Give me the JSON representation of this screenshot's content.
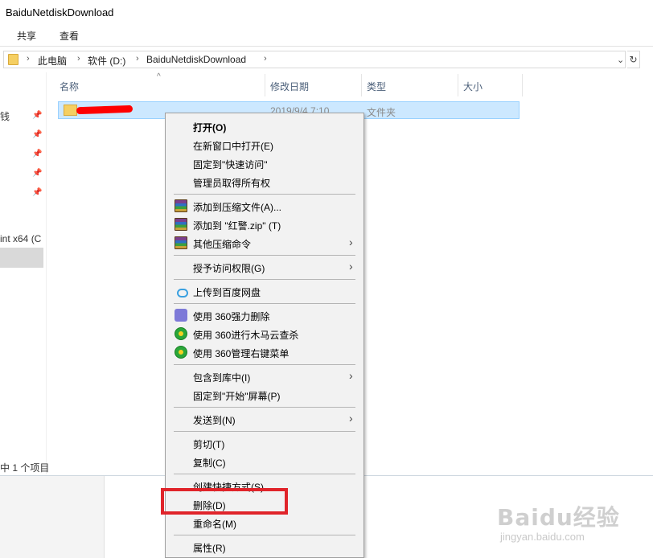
{
  "window": {
    "title": "BaiduNetdiskDownload"
  },
  "ribbon": {
    "tabs": [
      "共享",
      "查看"
    ]
  },
  "address": {
    "crumbs": [
      "此电脑",
      "软件 (D:)",
      "BaiduNetdiskDownload"
    ],
    "separator": "›",
    "dropdown_icon": "chevron-down-icon",
    "refresh_icon": "refresh-icon"
  },
  "nav": {
    "partial_label_1": "钱",
    "partial_label_2": "int x64 (C"
  },
  "columns": {
    "name": "名称",
    "modified": "修改日期",
    "type": "类型",
    "size": "大小",
    "sort_indicator": "^"
  },
  "files": [
    {
      "name": "[redacted]",
      "modified": "2019/9/4 7:10",
      "type": "文件夹",
      "size": ""
    }
  ],
  "status": {
    "count": "1 个项目",
    "prefix": "中"
  },
  "context_menu": {
    "groups": [
      [
        {
          "label": "打开(O)",
          "bold": true
        },
        {
          "label": "在新窗口中打开(E)"
        },
        {
          "label": "固定到\"快速访问\""
        },
        {
          "label": "管理员取得所有权"
        }
      ],
      [
        {
          "label": "添加到压缩文件(A)...",
          "icon": "winrar-icon"
        },
        {
          "label": "添加到 \"红警.zip\" (T)",
          "icon": "winrar-icon"
        },
        {
          "label": "其他压缩命令",
          "icon": "winrar-icon",
          "submenu": true
        }
      ],
      [
        {
          "label": "授予访问权限(G)",
          "submenu": true
        }
      ],
      [
        {
          "label": "上传到百度网盘",
          "icon": "baidu-netdisk-icon"
        }
      ],
      [
        {
          "label": "使用 360强力删除",
          "icon": "360-shred-icon"
        },
        {
          "label": "使用 360进行木马云查杀",
          "icon": "360-security-icon"
        },
        {
          "label": "使用 360管理右键菜单",
          "icon": "360-security-icon"
        }
      ],
      [
        {
          "label": "包含到库中(I)",
          "submenu": true
        },
        {
          "label": "固定到\"开始\"屏幕(P)"
        }
      ],
      [
        {
          "label": "发送到(N)",
          "submenu": true
        }
      ],
      [
        {
          "label": "剪切(T)"
        },
        {
          "label": "复制(C)"
        }
      ],
      [
        {
          "label": "创建快捷方式(S)"
        },
        {
          "label": "删除(D)",
          "highlighted": true
        },
        {
          "label": "重命名(M)"
        }
      ],
      [
        {
          "label": "属性(R)"
        }
      ]
    ]
  },
  "annotation": {
    "color": "#e0242a",
    "target": "删除(D)"
  },
  "watermark": {
    "brand": "Baidu经验",
    "url": "jingyan.baidu.com"
  },
  "colors": {
    "selection": "#cce8ff",
    "menu_bg": "#f2f2f2",
    "highlight": "#e0242a"
  }
}
